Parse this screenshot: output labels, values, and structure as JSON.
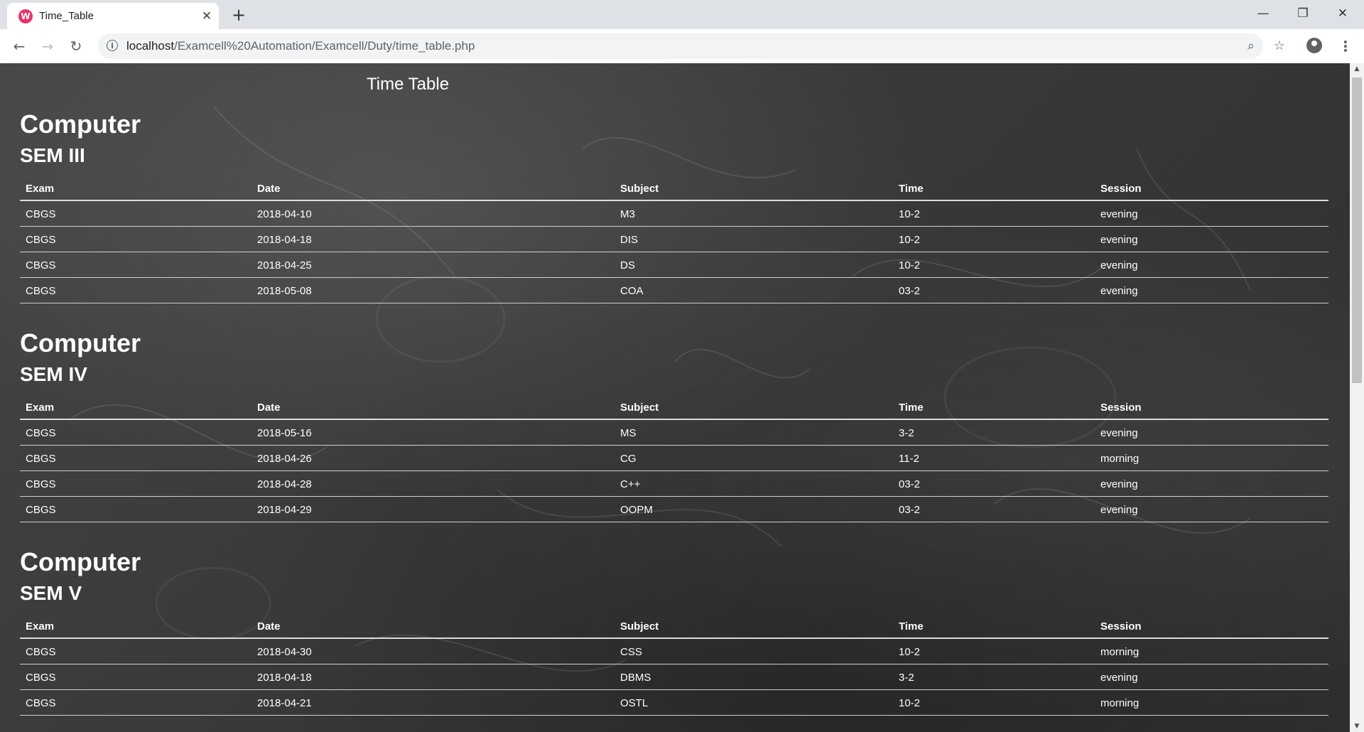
{
  "browser": {
    "tab_title": "Time_Table",
    "favicon_letter": "W",
    "favicon_color": "#e8336a",
    "url_host": "localhost",
    "url_path": "/Examcell%20Automation/Examcell/Duty/time_table.php"
  },
  "page": {
    "title": "Time Table",
    "columns": [
      "Exam",
      "Date",
      "Subject",
      "Time",
      "Session"
    ],
    "sections": [
      {
        "dept": "Computer",
        "sem": "SEM III",
        "rows": [
          [
            "CBGS",
            "2018-04-10",
            "M3",
            "10-2",
            "evening"
          ],
          [
            "CBGS",
            "2018-04-18",
            "DIS",
            "10-2",
            "evening"
          ],
          [
            "CBGS",
            "2018-04-25",
            "DS",
            "10-2",
            "evening"
          ],
          [
            "CBGS",
            "2018-05-08",
            "COA",
            "03-2",
            "evening"
          ]
        ]
      },
      {
        "dept": "Computer",
        "sem": "SEM IV",
        "rows": [
          [
            "CBGS",
            "2018-05-16",
            "MS",
            "3-2",
            "evening"
          ],
          [
            "CBGS",
            "2018-04-26",
            "CG",
            "11-2",
            "morning"
          ],
          [
            "CBGS",
            "2018-04-28",
            "C++",
            "03-2",
            "evening"
          ],
          [
            "CBGS",
            "2018-04-29",
            "OOPM",
            "03-2",
            "evening"
          ]
        ]
      },
      {
        "dept": "Computer",
        "sem": "SEM V",
        "rows": [
          [
            "CBGS",
            "2018-04-30",
            "CSS",
            "10-2",
            "morning"
          ],
          [
            "CBGS",
            "2018-04-18",
            "DBMS",
            "3-2",
            "evening"
          ],
          [
            "CBGS",
            "2018-04-21",
            "OSTL",
            "10-2",
            "morning"
          ]
        ]
      }
    ]
  }
}
